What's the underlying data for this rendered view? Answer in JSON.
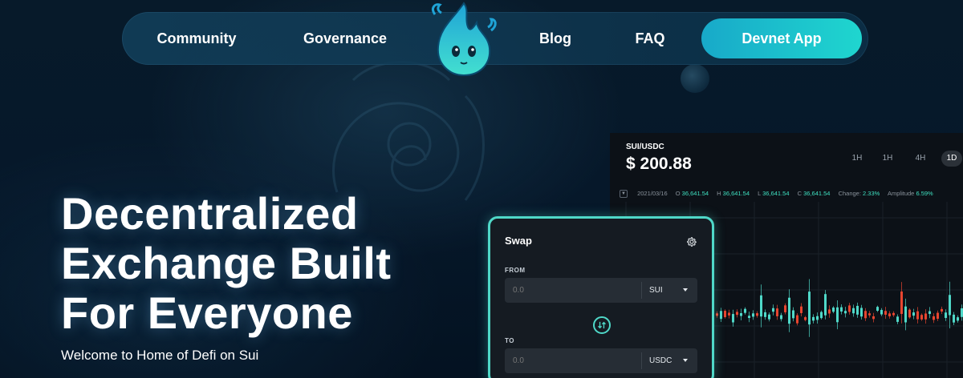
{
  "nav": {
    "community": "Community",
    "governance": "Governance",
    "blog": "Blog",
    "faq": "FAQ",
    "cta": "Devnet App"
  },
  "hero": {
    "title_lines": [
      "Decentralized",
      "Exchange Built",
      "For Everyone"
    ],
    "subtitle": "Welcome to Home of Defi on Sui"
  },
  "chart": {
    "pair": "SUI/USDC",
    "price": "$ 200.88",
    "timeframes": [
      "1H",
      "1H",
      "4H",
      "1D"
    ],
    "active_timeframe": "1D",
    "date": "2021/03/16",
    "open_label": "O",
    "open": "36,641.54",
    "high_label": "H",
    "high": "36,641.54",
    "low_label": "L",
    "low": "36,641.54",
    "close_label": "C",
    "close": "36,641.54",
    "change_label": "Change:",
    "change": "2.33%",
    "amplitude_label": "Amplitude",
    "amplitude": "6.59%",
    "up_color": "#4fd8c8",
    "down_color": "#e8452f"
  },
  "swap": {
    "title": "Swap",
    "from_label": "FROM",
    "from_placeholder": "0.0",
    "from_token": "SUI",
    "to_label": "TO",
    "to_placeholder": "0.0",
    "to_token": "USDC"
  },
  "colors": {
    "accent": "#1fd6cf",
    "accent_dark": "#18a9c9",
    "panel": "#151b22"
  },
  "icons": {
    "logo": "flame-mascot-icon",
    "settings": "gear-icon",
    "swap_direction": "swap-arrows-icon",
    "dropdown": "caret-down-icon"
  }
}
